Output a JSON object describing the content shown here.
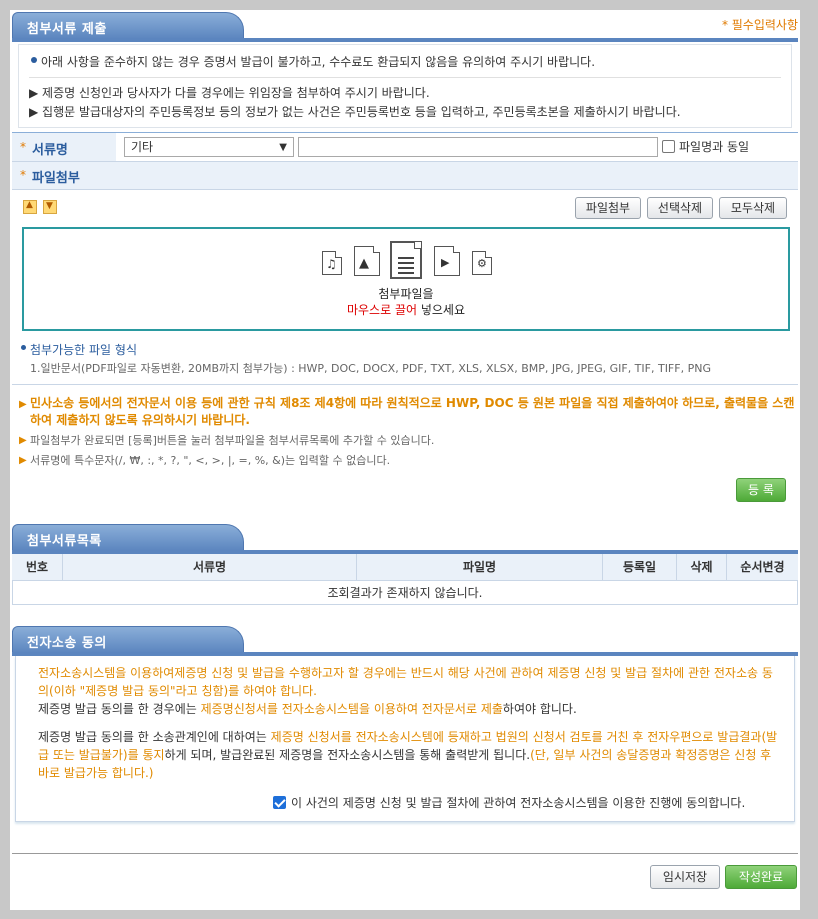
{
  "section1": {
    "title": "첨부서류 제출",
    "required_note": "* 필수입력사항",
    "notice_line": "아래 사항을 준수하지 않는 경우 증명서 발급이 불가하고, 수수료도 환급되지 않음을 유의하여 주시기 바랍니다.",
    "notice_items": [
      "▶ 제증명 신청인과 당사자가 다를 경우에는 위임장을 첨부하여 주시기 바랍니다.",
      "▶ 집행문 발급대상자의 주민등록정보 등의 정보가 없는 사건은 주민등록번호 등을 입력하고, 주민등록초본을 제출하시기 바랍니다."
    ],
    "docname_label": "서류명",
    "docname_select": "기타",
    "docname_input": "",
    "same_as_filename": "파일명과 동일",
    "attach_label": "파일첨부",
    "btn_attach": "파일첨부",
    "btn_select_delete": "선택삭제",
    "btn_delete_all": "모두삭제",
    "drop_text1": "첨부파일을",
    "drop_text2_red": "마우스로 끌어",
    "drop_text2_rest": " 넣으세요",
    "formats_title": "첨부가능한 파일 형식",
    "formats_line": "1.일반문서(PDF파일로 자동변환, 20MB까지 첨부가능) : HWP, DOC, DOCX, PDF, TXT, XLS, XLSX, BMP, JPG, JPEG, GIF, TIF, TIFF, PNG",
    "warn_bold": "민사소송 등에서의 전자문서 이용 등에 관한 규칙 제8조 제4항에 따라 원칙적으로 HWP, DOC 등 원본 파일을 직접 제출하여야 하므로, 출력물을 스캔하여 제출하지 않도록 유의하시기 바랍니다.",
    "warn2": "파일첨부가 완료되면 [등록]버튼을 눌러 첨부파일을 첨부서류목록에 추가할 수 있습니다.",
    "warn3": "서류명에 특수문자(/, ₩, :, *, ?, \", <, >, |, =, %, &)는 입력할 수 없습니다.",
    "btn_register": "등 록"
  },
  "section2": {
    "title": "첨부서류목록",
    "columns": [
      "번호",
      "서류명",
      "파일명",
      "등록일",
      "삭제",
      "순서변경"
    ],
    "empty": "조회결과가 존재하지 않습니다."
  },
  "section3": {
    "title": "전자소송 동의",
    "p1": "전자소송시스템을 이용하여제증명 신청 및 발급을 수행하고자 할 경우에는 반드시 해당 사건에 관하여 제증명 신청 및 발급 절차에 관한 전자소송 동의(이하 \"제증명 발급 동의\"라고 칭함)를 하여야 합니다.",
    "p2_a": "제증명 발급 동의를 한 경우에는 ",
    "p2_b": "제증명신청서를 전자소송시스템을 이용하여 전자문서로 제출",
    "p2_c": "하여야 합니다.",
    "p3_a": "제증명 발급 동의를 한 소송관계인에 대하여는 ",
    "p3_b": "제증명 신청서를 전자소송시스템에 등재하고 법원의 신청서 검토를 거친 후 전자우편으로 발급결과(발급 또는 발급불가)를 통지",
    "p3_c": "하게 되며, 발급완료된 제증명을 전자소송시스템을 통해 출력받게 됩니다.",
    "p3_d": "(단, 일부 사건의 송달증명과 확정증명은 신청 후 바로 발급가능 합니다.)",
    "agree": "이 사건의 제증명 신청 및 발급 절차에 관하여 전자소송시스템을 이용한 진행에 동의합니다."
  },
  "footer": {
    "btn_temp": "임시저장",
    "btn_done": "작성완료"
  },
  "colors": {
    "tab": "#5b85bf",
    "orange": "#e08a00",
    "green": "#4eaa37"
  }
}
